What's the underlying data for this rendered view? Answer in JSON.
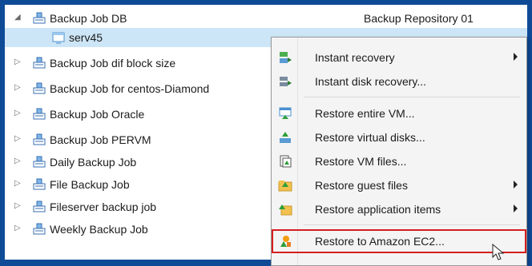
{
  "tree": {
    "rows": [
      {
        "label": "Backup Job DB",
        "repository": "Backup Repository 01",
        "expander": "expanded",
        "icon": "backup-job-icon"
      },
      {
        "label": "serv45",
        "repository": "",
        "expander": "none",
        "icon": "vm-icon",
        "selected": true
      },
      {
        "label": "Backup Job dif block size",
        "repository": "",
        "expander": "collapsed",
        "icon": "backup-job-icon"
      },
      {
        "label": "Backup Job for centos-Diamond",
        "repository": "",
        "expander": "collapsed",
        "icon": "backup-job-icon"
      },
      {
        "label": "Backup Job Oracle",
        "repository": "",
        "expander": "collapsed",
        "icon": "backup-job-icon"
      },
      {
        "label": "Backup Job PERVM",
        "repository": "",
        "expander": "collapsed",
        "icon": "backup-job-icon"
      },
      {
        "label": "Daily Backup Job",
        "repository": "",
        "expander": "collapsed",
        "icon": "backup-job-icon"
      },
      {
        "label": "File Backup Job",
        "repository": "",
        "expander": "collapsed",
        "icon": "backup-job-icon"
      },
      {
        "label": "Fileserver backup job",
        "repository": "",
        "expander": "collapsed",
        "icon": "backup-job-icon"
      },
      {
        "label": "Weekly Backup Job",
        "repository": "",
        "expander": "collapsed",
        "icon": "backup-job-icon"
      }
    ]
  },
  "context_menu": {
    "items": [
      {
        "label": "Instant recovery",
        "icon": "instant-recovery-icon",
        "submenu": true
      },
      {
        "label": "Instant disk recovery...",
        "icon": "instant-disk-recovery-icon",
        "submenu": false
      },
      {
        "label": "Restore entire VM...",
        "icon": "restore-vm-icon",
        "submenu": false
      },
      {
        "label": "Restore virtual disks...",
        "icon": "restore-disks-icon",
        "submenu": false
      },
      {
        "label": "Restore VM files...",
        "icon": "restore-vm-files-icon",
        "submenu": false
      },
      {
        "label": "Restore guest files",
        "icon": "restore-guest-files-icon",
        "submenu": true
      },
      {
        "label": "Restore application items",
        "icon": "restore-app-items-icon",
        "submenu": true
      },
      {
        "label": "Restore to Amazon EC2...",
        "icon": "amazon-ec2-icon",
        "submenu": false,
        "highlighted": true
      }
    ]
  },
  "colors": {
    "frame": "#0f4a97",
    "selection": "#cde6f7",
    "highlight_border": "#d61d1d"
  }
}
